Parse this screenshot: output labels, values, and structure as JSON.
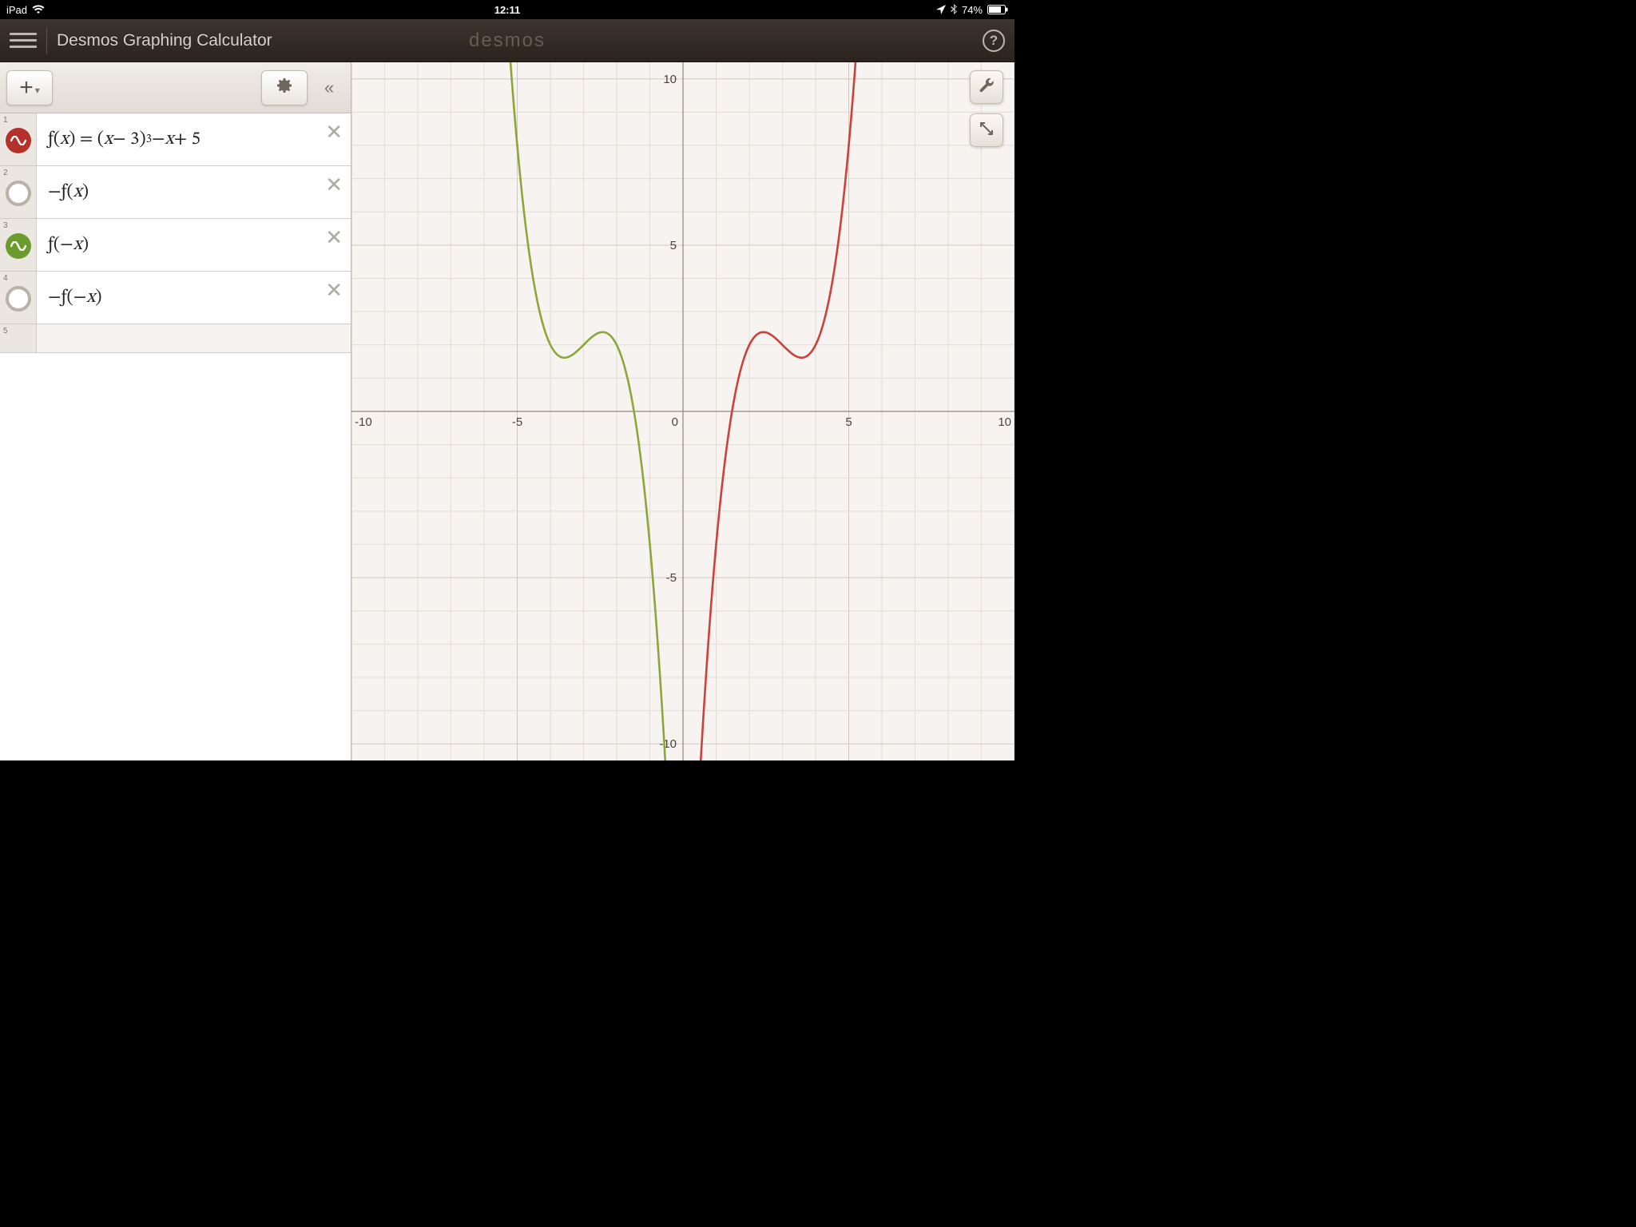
{
  "status_bar": {
    "device": "iPad",
    "time": "12:11",
    "battery_pct": "74%"
  },
  "header": {
    "title": "Desmos Graphing Calculator",
    "brand": "desmos",
    "help": "?"
  },
  "toolbar": {
    "add": "+",
    "caret": "▾",
    "collapse": "«"
  },
  "expressions": [
    {
      "num": "1",
      "color": "red",
      "enabled": true,
      "expr_html": "<span class='notital'>ƒ(</span>x<span class='notital'>) = (</span>x<span class='notital'> − 3)</span><span class='sup'>3</span><span class='notital'> − </span>x<span class='notital'> + 5</span>"
    },
    {
      "num": "2",
      "color": "off",
      "enabled": false,
      "expr_html": "<span class='notital'>−ƒ(</span>x<span class='notital'>)</span>"
    },
    {
      "num": "3",
      "color": "green",
      "enabled": true,
      "expr_html": "<span class='notital'>ƒ(−</span>x<span class='notital'>)</span>"
    },
    {
      "num": "4",
      "color": "off",
      "enabled": false,
      "expr_html": "<span class='notital'>−ƒ(−</span>x<span class='notital'>)</span>"
    },
    {
      "num": "5",
      "color": "none",
      "enabled": false,
      "expr_html": ""
    }
  ],
  "chart_data": {
    "type": "line",
    "xlim": [
      -10,
      10
    ],
    "ylim": [
      -10.5,
      10.5
    ],
    "x_ticks": [
      -10,
      -5,
      0,
      5,
      10
    ],
    "y_ticks": [
      -10,
      -5,
      5,
      10
    ],
    "xlabel": "",
    "ylabel": "",
    "title": "",
    "grid": {
      "minor_step": 1,
      "major_step": 5
    },
    "series": [
      {
        "name": "f(x) = (x−3)^3 − x + 5",
        "color": "#c9423c",
        "formula": "Math.pow(x-3,3) - x + 5"
      },
      {
        "name": "f(−x) = (−x−3)^3 + x + 5",
        "color": "#8aa83a",
        "formula": "Math.pow(-x-3,3) + x + 5"
      }
    ]
  }
}
